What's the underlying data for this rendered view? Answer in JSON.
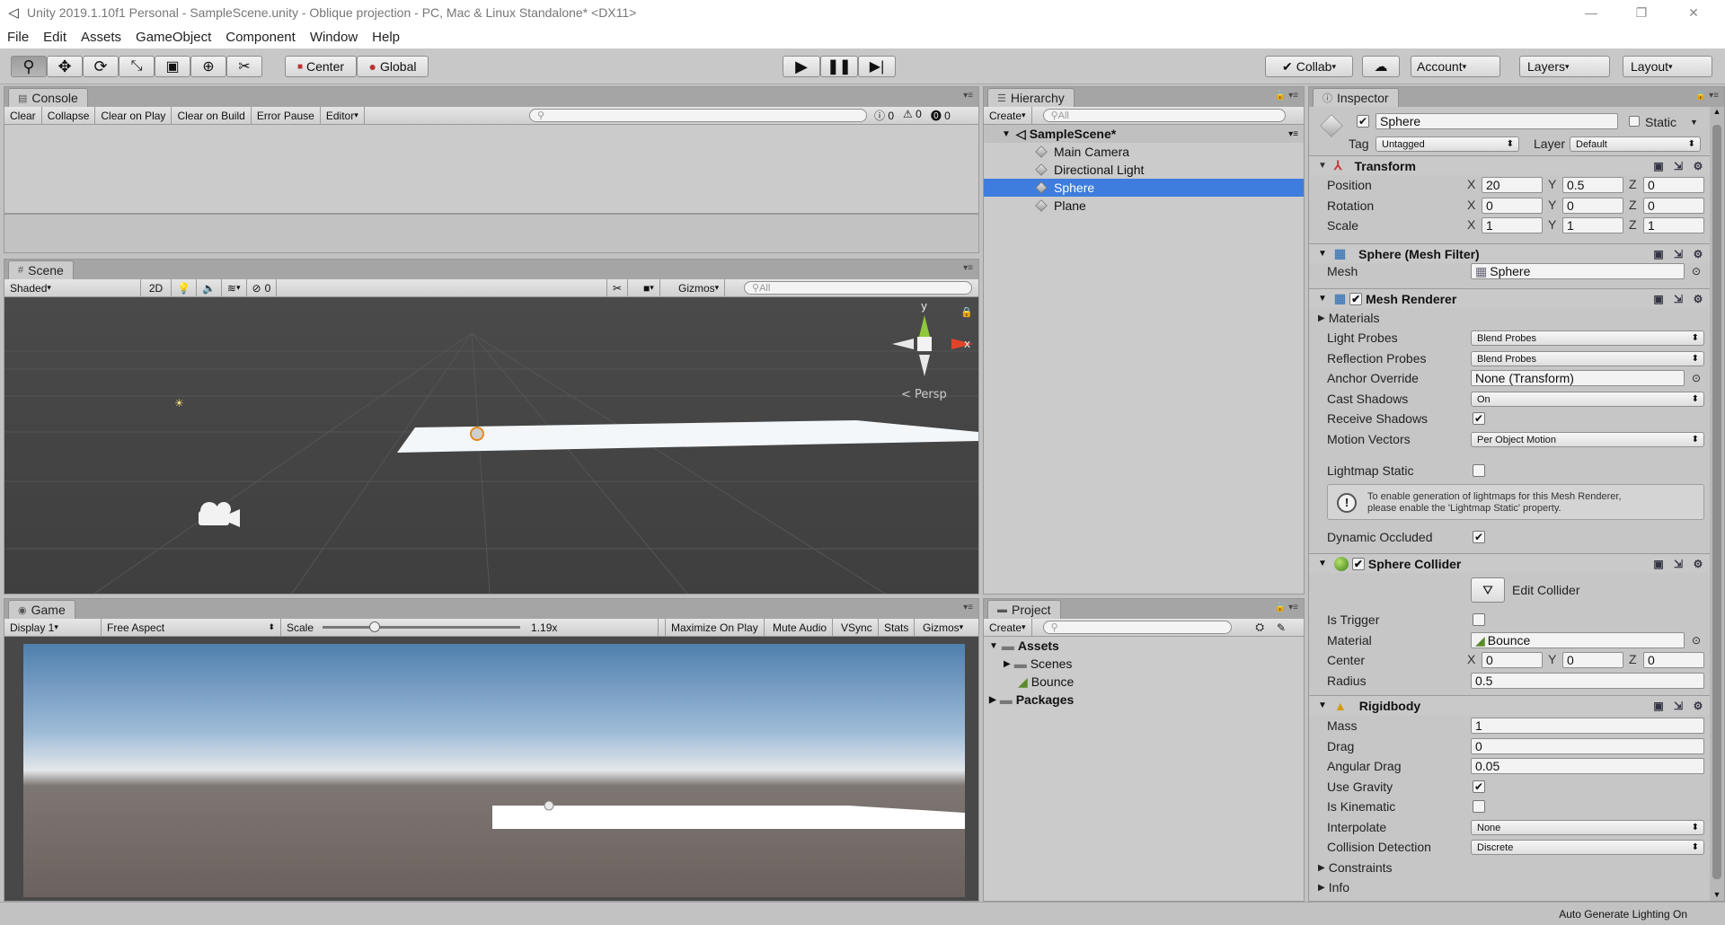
{
  "titlebar": {
    "title": "Unity 2019.1.10f1 Personal - SampleScene.unity - Oblique projection - PC, Mac & Linux Standalone* <DX11>"
  },
  "menu": [
    "File",
    "Edit",
    "Assets",
    "GameObject",
    "Component",
    "Window",
    "Help"
  ],
  "toolbar": {
    "pivot": "Center",
    "space": "Global",
    "collab": "Collab",
    "account": "Account",
    "layers": "Layers",
    "layout": "Layout"
  },
  "console": {
    "tab": "Console",
    "buttons": [
      "Clear",
      "Collapse",
      "Clear on Play",
      "Clear on Build",
      "Error Pause",
      "Editor"
    ],
    "counts": {
      "info": "0",
      "warn": "0",
      "error": "0"
    }
  },
  "scene": {
    "tab": "Scene",
    "shading": "Shaded",
    "mode2d": "2D",
    "hidden_count": "0",
    "gizmos": "Gizmos",
    "search_placeholder": "All",
    "axis_y": "y",
    "axis_x": "x",
    "persp": "< Persp"
  },
  "game": {
    "tab": "Game",
    "display": "Display 1",
    "aspect": "Free Aspect",
    "scale_label": "Scale",
    "scale_value": "1.19x",
    "buttons": [
      "Maximize On Play",
      "Mute Audio",
      "VSync",
      "Stats",
      "Gizmos"
    ]
  },
  "hierarchy": {
    "tab": "Hierarchy",
    "create": "Create",
    "search_placeholder": "All",
    "scene": "SampleScene*",
    "items": [
      "Main Camera",
      "Directional Light",
      "Sphere",
      "Plane"
    ],
    "selected": "Sphere"
  },
  "project": {
    "tab": "Project",
    "create": "Create",
    "assets": "Assets",
    "scenes": "Scenes",
    "bounce": "Bounce",
    "packages": "Packages"
  },
  "inspector": {
    "tab": "Inspector",
    "name": "Sphere",
    "static_label": "Static",
    "tag_label": "Tag",
    "tag": "Untagged",
    "layer_label": "Layer",
    "layer": "Default",
    "transform": {
      "title": "Transform",
      "position_label": "Position",
      "position": [
        "20",
        "0.5",
        "0"
      ],
      "rotation_label": "Rotation",
      "rotation": [
        "0",
        "0",
        "0"
      ],
      "scale_label": "Scale",
      "scale": [
        "1",
        "1",
        "1"
      ]
    },
    "mesh_filter": {
      "title": "Sphere (Mesh Filter)",
      "mesh_label": "Mesh",
      "mesh": "Sphere"
    },
    "mesh_renderer": {
      "title": "Mesh Renderer",
      "materials": "Materials",
      "light_probes_label": "Light Probes",
      "light_probes": "Blend Probes",
      "reflection_probes_label": "Reflection Probes",
      "reflection_probes": "Blend Probes",
      "anchor_label": "Anchor Override",
      "anchor": "None (Transform)",
      "cast_shadows_label": "Cast Shadows",
      "cast_shadows": "On",
      "receive_shadows_label": "Receive Shadows",
      "motion_vectors_label": "Motion Vectors",
      "motion_vectors": "Per Object Motion",
      "lightmap_static_label": "Lightmap Static",
      "info_line1": "To enable generation of lightmaps for this Mesh Renderer,",
      "info_line2": "please enable the 'Lightmap Static' property.",
      "dynamic_occluded_label": "Dynamic Occluded"
    },
    "sphere_collider": {
      "title": "Sphere Collider",
      "edit": "Edit Collider",
      "is_trigger_label": "Is Trigger",
      "material_label": "Material",
      "material": "Bounce",
      "center_label": "Center",
      "center": [
        "0",
        "0",
        "0"
      ],
      "radius_label": "Radius",
      "radius": "0.5"
    },
    "rigidbody": {
      "title": "Rigidbody",
      "mass_label": "Mass",
      "mass": "1",
      "drag_label": "Drag",
      "drag": "0",
      "angular_drag_label": "Angular Drag",
      "angular_drag": "0.05",
      "use_gravity_label": "Use Gravity",
      "is_kinematic_label": "Is Kinematic",
      "interpolate_label": "Interpolate",
      "interpolate": "None",
      "collision_label": "Collision Detection",
      "collision": "Discrete",
      "constraints": "Constraints",
      "info": "Info"
    }
  },
  "status": {
    "text": "Auto Generate Lighting On"
  }
}
